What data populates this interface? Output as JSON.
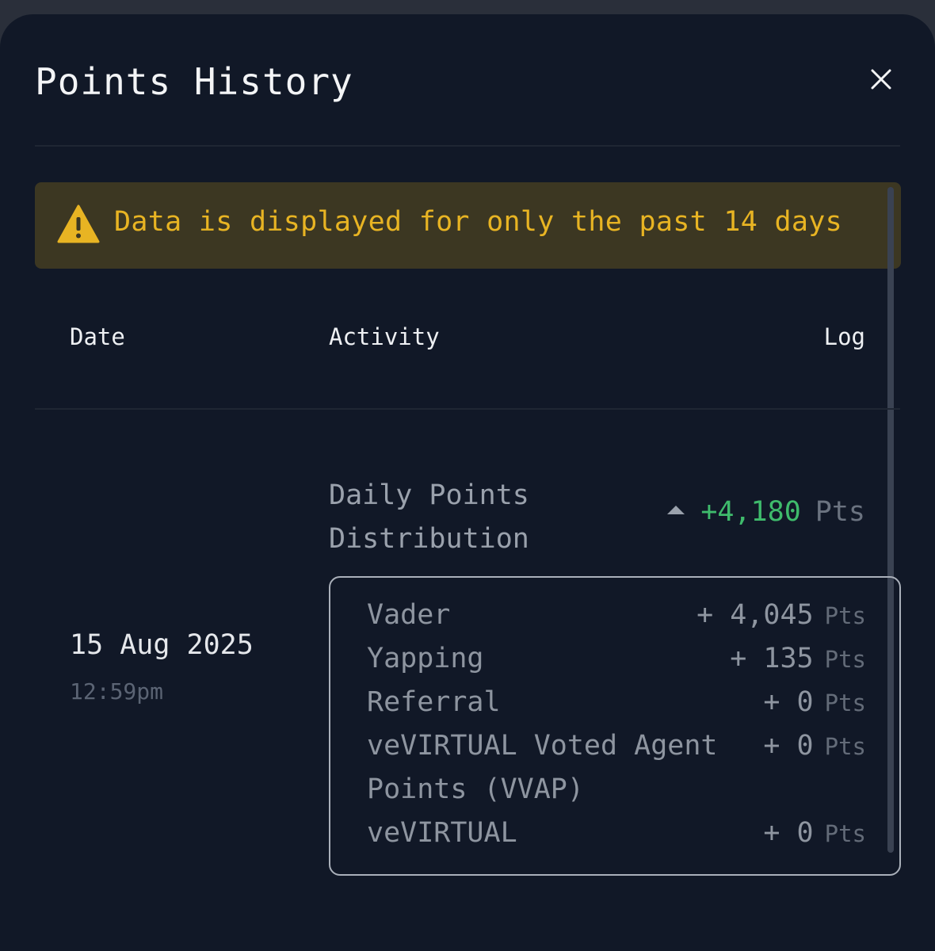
{
  "header": {
    "title": "Points History",
    "close_icon": "close-icon"
  },
  "notice": {
    "icon": "warning-icon",
    "text": "Data is displayed for only the past 14 days",
    "color": "#e8b423"
  },
  "table": {
    "columns": [
      "Date",
      "Activity",
      "Log"
    ],
    "rows": [
      {
        "date": "15 Aug 2025",
        "time": "12:59pm",
        "activity": "Daily Points Distribution",
        "total": "+4,180",
        "unit": "Pts",
        "breakdown": [
          {
            "label": "Vader",
            "value": "+ 4,045",
            "unit": "Pts"
          },
          {
            "label": "Yapping",
            "value": "+ 135",
            "unit": "Pts"
          },
          {
            "label": "Referral",
            "value": "+ 0",
            "unit": "Pts"
          },
          {
            "label": "veVIRTUAL Voted Agent Points (VVAP)",
            "value": "+ 0",
            "unit": "Pts"
          },
          {
            "label": "veVIRTUAL",
            "value": "+ 0",
            "unit": "Pts"
          }
        ]
      }
    ]
  },
  "colors": {
    "background": "#111827",
    "positive": "#3fbb6c",
    "warning_bg": "#3c3722"
  }
}
